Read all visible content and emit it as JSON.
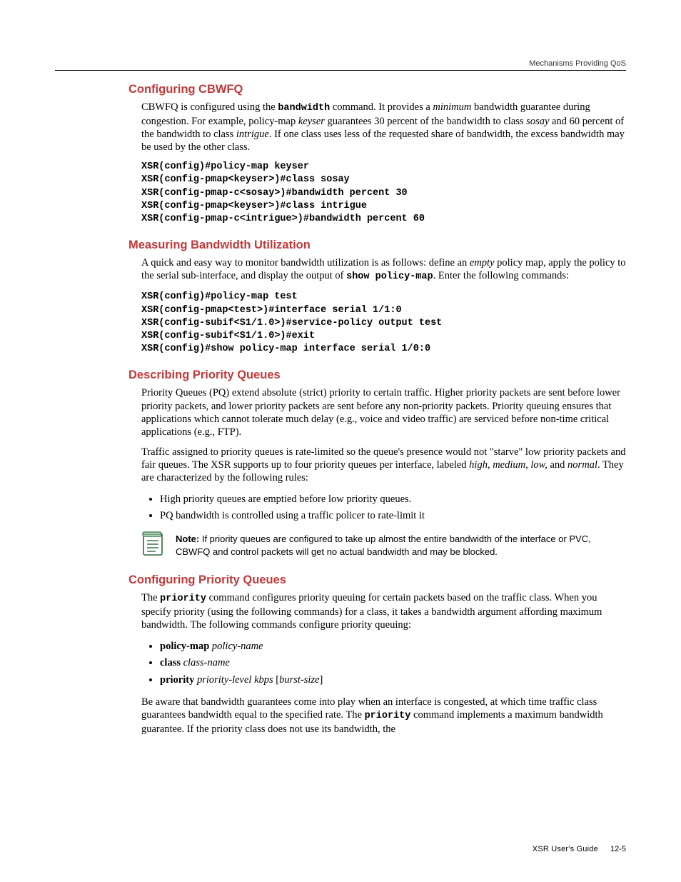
{
  "running_head": "Mechanisms Providing QoS",
  "footer": {
    "label": "XSR User's Guide",
    "page": "12-5"
  },
  "s1": {
    "title": "Configuring CBWFQ",
    "p1_pre": "CBWFQ is configured using the ",
    "p1_cmd": "bandwidth",
    "p1_mid1": " command. It provides a ",
    "p1_ital1": "minimum",
    "p1_mid2": " bandwidth guarantee during congestion. For example, policy-map ",
    "p1_ital2": "keyser",
    "p1_mid3": " guarantees 30 percent of the bandwidth to class ",
    "p1_ital3": "sosay",
    "p1_mid4": " and 60 percent of the bandwidth to class ",
    "p1_ital4": "intrigue",
    "p1_post": ". If one class uses less of the requested share of bandwidth, the excess bandwidth may be used by the other class.",
    "code": "XSR(config)#policy-map keyser\nXSR(config-pmap<keyser>)#class sosay\nXSR(config-pmap-c<sosay>)#bandwidth percent 30\nXSR(config-pmap<keyser>)#class intrigue\nXSR(config-pmap-c<intrigue>)#bandwidth percent 60"
  },
  "s2": {
    "title": "Measuring Bandwidth Utilization",
    "p1_pre": "A quick and easy way to monitor bandwidth utilization is as follows: define an ",
    "p1_ital": "empty",
    "p1_mid": " policy map, apply the policy to the serial sub-interface, and display the output of ",
    "p1_cmd": "show policy-map",
    "p1_post": ". Enter the following commands:",
    "code": "XSR(config)#policy-map test\nXSR(config-pmap<test>)#interface serial 1/1:0\nXSR(config-subif<S1/1.0>)#service-policy output test\nXSR(config-subif<S1/1.0>)#exit\nXSR(config)#show policy-map interface serial 1/0:0"
  },
  "s3": {
    "title": "Describing Priority Queues",
    "p1": "Priority Queues (PQ) extend absolute (strict) priority to certain traffic. Higher priority packets are sent before lower priority packets, and lower priority packets are sent before any non-priority packets. Priority queuing ensures that applications which cannot tolerate much delay (e.g., voice and video traffic) are serviced before non-time critical applications (e.g., FTP).",
    "p2_pre": "Traffic assigned to priority queues is rate-limited so the queue's presence would not \"starve\" low priority packets and fair queues. The XSR supports up to four priority queues per interface, labeled ",
    "p2_ital1": "high, medium, low,",
    "p2_mid": " and ",
    "p2_ital2": "normal",
    "p2_post": ". They are characterized by the following rules:",
    "b1": "High priority queues are emptied before low priority queues.",
    "b2": "PQ bandwidth is controlled using a traffic policer to rate-limit it",
    "note_label": "Note:",
    "note_text": " If priority queues are configured to take up almost the entire bandwidth of the interface or PVC, CBWFQ and control packets will get no actual bandwidth and may be blocked."
  },
  "s4": {
    "title": "Configuring Priority Queues",
    "p1_pre": "The ",
    "p1_cmd": "priority",
    "p1_post": " command configures priority queuing for certain packets based on the traffic class. When you specify priority (using the following commands) for a class, it takes a bandwidth argument affording maximum bandwidth. The following commands configure priority queuing:",
    "b1_bold": "policy-map",
    "b1_ital": " policy-name",
    "b2_bold": "class",
    "b2_ital": " class-name",
    "b3_bold": "priority",
    "b3_ital1": " priority-level kbps",
    "b3_lb": " [",
    "b3_ital2": "burst-size",
    "b3_rb": "]",
    "p2_pre": "Be aware that bandwidth guarantees come into play when an interface is congested, at which time traffic class guarantees bandwidth equal to the specified rate. The ",
    "p2_cmd": "priority",
    "p2_post": " command implements a maximum bandwidth guarantee. If the priority class does not use its bandwidth, the"
  }
}
